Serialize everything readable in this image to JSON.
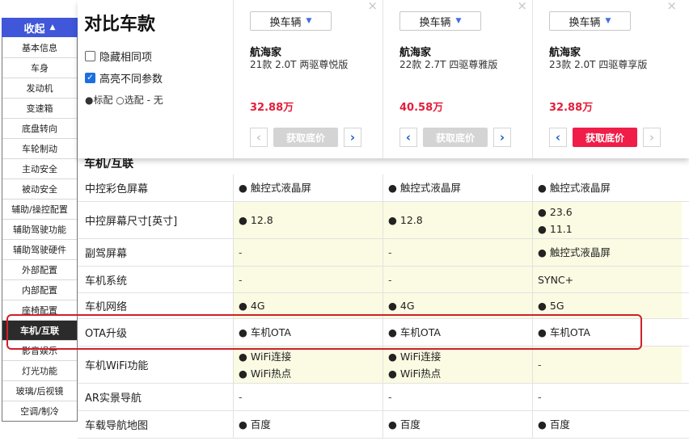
{
  "sidebar": {
    "collapse_label": "收起",
    "items": [
      {
        "label": "基本信息"
      },
      {
        "label": "车身"
      },
      {
        "label": "发动机"
      },
      {
        "label": "变速箱"
      },
      {
        "label": "底盘转向"
      },
      {
        "label": "车轮制动"
      },
      {
        "label": "主动安全"
      },
      {
        "label": "被动安全"
      },
      {
        "label": "辅助/操控配置"
      },
      {
        "label": "辅助驾驶功能"
      },
      {
        "label": "辅助驾驶硬件"
      },
      {
        "label": "外部配置"
      },
      {
        "label": "内部配置"
      },
      {
        "label": "座椅配置"
      },
      {
        "label": "车机/互联",
        "active": true
      },
      {
        "label": "影音娱乐"
      },
      {
        "label": "灯光功能"
      },
      {
        "label": "玻璃/后视镜"
      },
      {
        "label": "空调/制冷"
      }
    ]
  },
  "header": {
    "title": "对比车款",
    "options": {
      "hide_same": "隐藏相同项",
      "highlight_diff": "高亮不同参数",
      "hide_same_checked": false,
      "highlight_diff_checked": true
    },
    "legend": "●标配 ○选配 - 无",
    "cars": [
      {
        "swap_label": "换车辆",
        "name": "航海家",
        "trim": "21款 2.0T 两驱尊悦版",
        "price": "32.88万",
        "quote_label": "获取底价",
        "quote_active": false
      },
      {
        "swap_label": "换车辆",
        "name": "航海家",
        "trim": "22款 2.7T 四驱尊雅版",
        "price": "40.58万",
        "quote_label": "获取底价",
        "quote_active": false
      },
      {
        "swap_label": "换车辆",
        "name": "航海家",
        "trim": "23款 2.0T 四驱尊享版",
        "price": "32.88万",
        "quote_label": "获取底价",
        "quote_active": true
      }
    ]
  },
  "section_title": "车机/互联",
  "rows": [
    {
      "label": "中控彩色屏幕",
      "diff": false,
      "values": [
        [
          "● 触控式液晶屏"
        ],
        [
          "● 触控式液晶屏"
        ],
        [
          "● 触控式液晶屏"
        ]
      ]
    },
    {
      "label": "中控屏幕尺寸[英寸]",
      "diff": true,
      "values": [
        [
          "● 12.8"
        ],
        [
          "● 12.8"
        ],
        [
          "● 23.6",
          "● 11.1"
        ]
      ]
    },
    {
      "label": "副驾屏幕",
      "diff": true,
      "values": [
        [
          "-"
        ],
        [
          "-"
        ],
        [
          "● 触控式液晶屏"
        ]
      ]
    },
    {
      "label": "车机系统",
      "diff": true,
      "values": [
        [
          "-"
        ],
        [
          "-"
        ],
        [
          "SYNC+"
        ]
      ]
    },
    {
      "label": "车机网络",
      "diff": true,
      "values": [
        [
          "● 4G"
        ],
        [
          "● 4G"
        ],
        [
          "● 5G"
        ]
      ]
    },
    {
      "label": "OTA升级",
      "diff": false,
      "values": [
        [
          "● 车机OTA"
        ],
        [
          "● 车机OTA"
        ],
        [
          "● 车机OTA"
        ]
      ]
    },
    {
      "label": "车机WiFi功能",
      "diff": true,
      "values": [
        [
          "● WiFi连接",
          "● WiFi热点"
        ],
        [
          "● WiFi连接",
          "● WiFi热点"
        ],
        [
          "-"
        ]
      ]
    },
    {
      "label": "AR实景导航",
      "diff": false,
      "values": [
        [
          "-"
        ],
        [
          "-"
        ],
        [
          "-"
        ]
      ]
    },
    {
      "label": "车载导航地图",
      "diff": false,
      "values": [
        [
          "● 百度"
        ],
        [
          "● 百度"
        ],
        [
          "● 百度"
        ]
      ]
    }
  ]
}
